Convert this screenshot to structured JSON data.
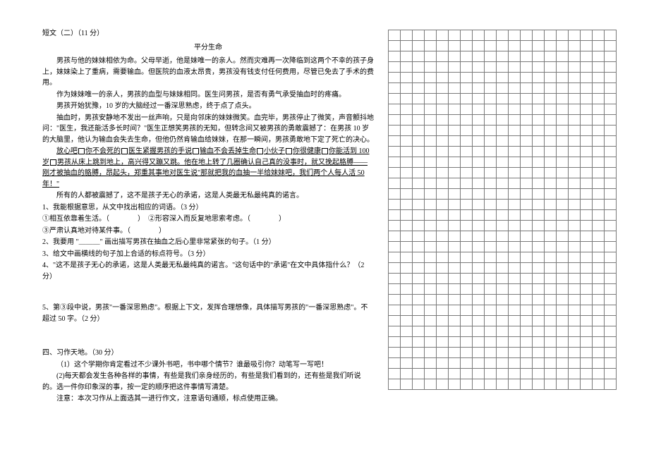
{
  "header": "短文（二）（11 分）",
  "title": "平分生命",
  "paragraphs": {
    "p1": "男孩与他的妹妹相依为命。父母早逝，他是妹唯一的亲人。然而灾难再一次降临到这两个不幸的孩子身上，妹妹染上了重病，需要输血。但医院的血液太昂贵，男孩没有钱支付任何费用，尽管已免去了手术的费用。",
    "p2": "作为妹妹唯一的亲人，男孩的血型与妹妹相同。医生问男孩，是否有勇气承受抽血时的疼痛。",
    "p3a": "男孩开始犹豫，10 岁的大脑经过一番深思熟虑，终于点了点头。",
    "p3b": "抽血时，男孩安静地不发出一丝声响，只是向邻床的妹妹微笑。血完毕，男孩停止了微笑，声音颤抖地问：\"医生，我还能活多长时间？\"医生正想笑男孩的无知，但转念间又被男孩的勇敢震撼了：在男孩 10 岁的大脑里，他认为输血会失去生命，但他仍然肯输血给妹妹，在那一瞬间，男孩勇敢地下定了死亡的决心。",
    "p4a": "放心吧",
    "p4b": "你不会死的",
    "p4c": "医生紧握男孩的手说",
    "p4d": "输血不会丢掉生命",
    "p4e": "小伙子",
    "p4f": "你很健康",
    "p4g": "你能活到 100 岁",
    "p4h": "男孩从床上跳到地上，高兴得又蹦又跳。他在地上转了几圈确认自己真的没事时，就又挽起胳膊——刚才被抽血的胳膊，昂起头，郑重其事地对医生说\"那就把我的血抽一半给妹妹吧，我们两个人每人活 50 年！\"",
    "p5": "所有的人都被震撼了，这不是孩子无心的承诺，这是人类最无私最纯真的诺言。"
  },
  "questions": {
    "q1": "1、我能根据意思，从文中找出相应的词语。（3 分）",
    "q1a": "①相互依靠着生活。（　　　　）　②形容深入而反复地思索考虑。（　　　　）",
    "q1b": "③严肃认真地对待某件事。（　　　　）",
    "q2": "2、我要用 \"＿＿＿\" 画出描写男孩在抽血之后心里非常紧张的句子。（1 分）",
    "q3": "3、给文中画横线的句子加上合适的标点符号。（3 分）",
    "q4": "4、\"这不是孩子无心的承诺，这是人类最无私最纯真的诺言。\"这句话中的\"承诺\"在文中具体指什么？（2 分）",
    "q5": "5、第③段中说，男孩\"一番深思熟虑\"。根据上下文，发挥合理想像，具体描写男孩的\"一番深思熟虑\"。不超过 50 字。（2 分）"
  },
  "section4": {
    "header": "四、习作天地。（30 分）",
    "item1": "（1）这个学期你肯定看过不少课外书吧，书中哪个情节？谁最吸引你？动笔写一写吧！",
    "item2": "(2)每天都会发生各种各样的事情，有些是我们亲身经历的，有些是我们看到的，还有些是我们听说的。选一件你印象深的事，按一定的顺序把这件事情写清楚。",
    "note": "注意：本次习作从上面选其一进行作文，注意语句通顺，标点使用正确。"
  },
  "grid": {
    "rows": 34,
    "cols": 19
  }
}
